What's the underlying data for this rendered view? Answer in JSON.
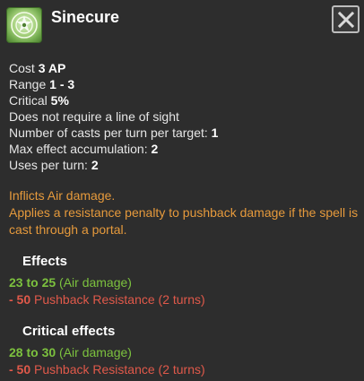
{
  "spell": {
    "name": "Sinecure",
    "icon": "spell-emblem-icon",
    "colors": {
      "icon_bg": "#8fc365",
      "effect_positive": "#7cc13e",
      "effect_negative": "#e0594a",
      "description": "#e69a3c"
    }
  },
  "stats": [
    {
      "label": "Cost",
      "value": "3 AP"
    },
    {
      "label": "Range",
      "value": "1 - 3"
    },
    {
      "label": "Critical",
      "value": "5%"
    },
    {
      "label": "Does not require a line of sight",
      "value": ""
    },
    {
      "label": "Number of casts per turn per target:",
      "value": "1"
    },
    {
      "label": "Max effect accumulation:",
      "value": "2"
    },
    {
      "label": "Uses per turn:",
      "value": "2"
    }
  ],
  "description": [
    "Inflicts Air damage.",
    "Applies a resistance penalty to pushback damage if the spell is cast through a portal."
  ],
  "effects": {
    "title": "Effects",
    "lines": [
      {
        "value": "23 to 25",
        "text": "(Air damage)",
        "kind": "positive"
      },
      {
        "value": "- 50",
        "text": "Pushback Resistance (2 turns)",
        "kind": "negative"
      }
    ]
  },
  "critical_effects": {
    "title": "Critical effects",
    "lines": [
      {
        "value": "28 to 30",
        "text": "(Air damage)",
        "kind": "positive"
      },
      {
        "value": "- 50",
        "text": "Pushback Resistance (2 turns)",
        "kind": "negative"
      }
    ]
  },
  "close_icon": "close-icon"
}
